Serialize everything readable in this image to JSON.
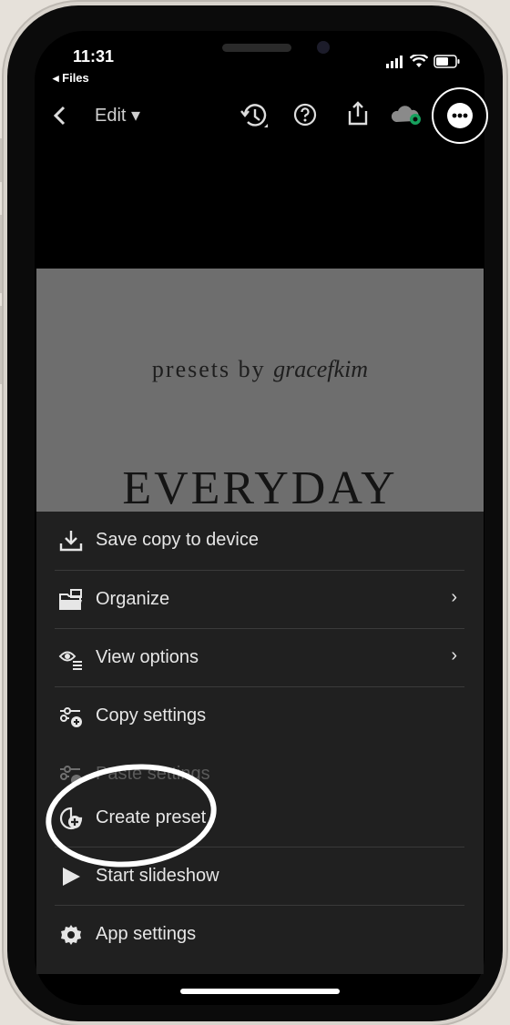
{
  "status_bar": {
    "time": "11:31",
    "back_app": "◂ Files"
  },
  "app_bar": {
    "edit_label": "Edit",
    "edit_caret": "▾",
    "back_icon": "chevron-left-icon"
  },
  "photo": {
    "line1_prefix": "presets by",
    "line1_script": "gracefkim",
    "line2": "EVERYDAY"
  },
  "menu": {
    "items": [
      {
        "label": "Save copy to device",
        "icon": "download-icon"
      },
      {
        "label": "Organize",
        "icon": "folder-icon",
        "chevron": "›"
      },
      {
        "label": "View options",
        "icon": "view-options-icon",
        "chevron": "›"
      },
      {
        "label": "Copy settings",
        "icon": "copy-settings-icon"
      },
      {
        "label": "Paste settings",
        "icon": "paste-settings-icon",
        "disabled": true
      },
      {
        "label": "Create preset",
        "icon": "create-preset-icon"
      },
      {
        "label": "Start slideshow",
        "icon": "play-icon"
      },
      {
        "label": "App settings",
        "icon": "gear-icon"
      }
    ]
  },
  "colors": {
    "sheet_bg": "#202020",
    "photo_bg": "#6e6e6e",
    "accent_green": "#17a05d"
  }
}
